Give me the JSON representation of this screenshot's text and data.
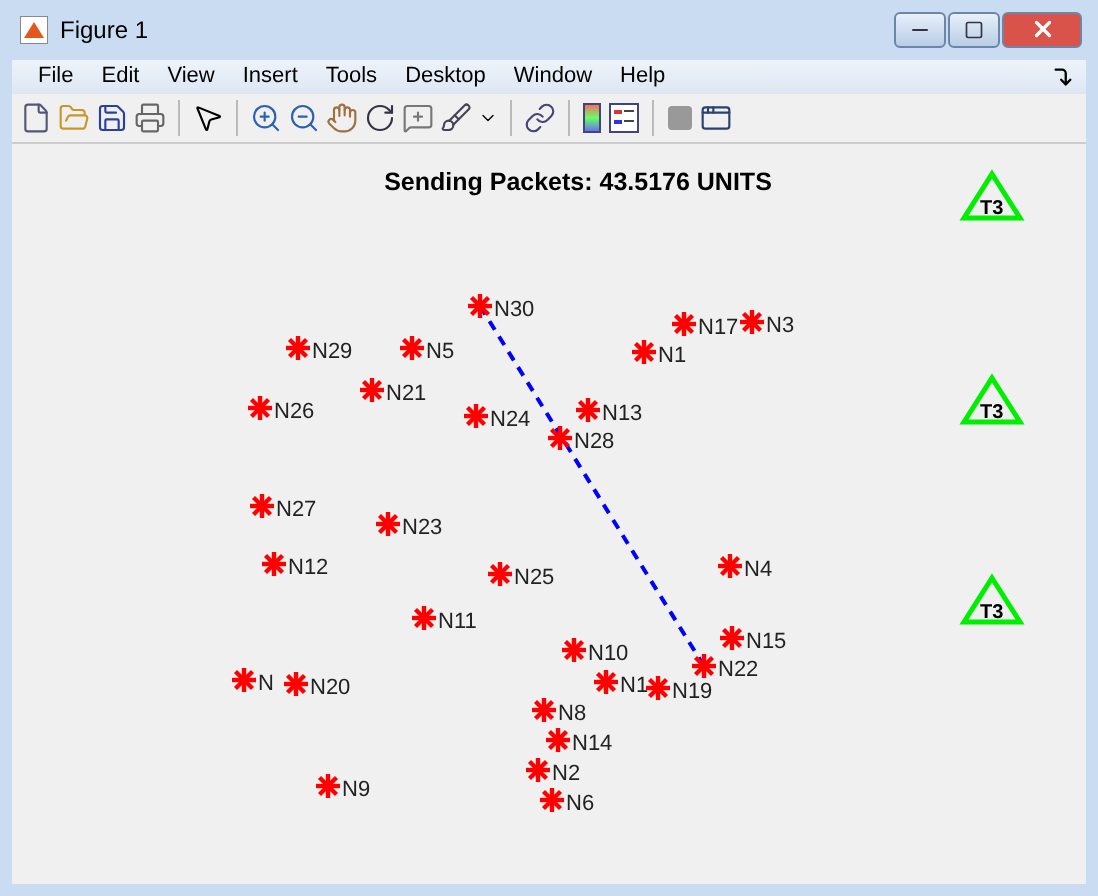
{
  "window": {
    "title": "Figure 1"
  },
  "menu": [
    "File",
    "Edit",
    "View",
    "Insert",
    "Tools",
    "Desktop",
    "Window",
    "Help"
  ],
  "plot": {
    "title": "Sending Packets: 43.5176 UNITS",
    "nodes": [
      {
        "label": "N30",
        "route": true
      },
      {
        "label": "N29"
      },
      {
        "label": "N5"
      },
      {
        "label": "N21"
      },
      {
        "label": "N26"
      },
      {
        "label": "N24"
      },
      {
        "label": "N27"
      },
      {
        "label": "N23"
      },
      {
        "label": "N12"
      },
      {
        "label": "N25"
      },
      {
        "label": "N11"
      },
      {
        "label": "N17"
      },
      {
        "label": "N3"
      },
      {
        "label": "N1"
      },
      {
        "label": "N28"
      },
      {
        "label": "N13"
      },
      {
        "label": "N4"
      },
      {
        "label": "N15"
      },
      {
        "label": "N22",
        "route": true
      },
      {
        "label": "N10"
      },
      {
        "label": "N1"
      },
      {
        "label": "N19"
      },
      {
        "label": "N"
      },
      {
        "label": "N20"
      },
      {
        "label": "N8"
      },
      {
        "label": "N14"
      },
      {
        "label": "N2"
      },
      {
        "label": "N6"
      },
      {
        "label": "N9"
      }
    ],
    "towers": [
      {
        "label": "T3"
      },
      {
        "label": "T3"
      },
      {
        "label": "T3"
      }
    ]
  }
}
